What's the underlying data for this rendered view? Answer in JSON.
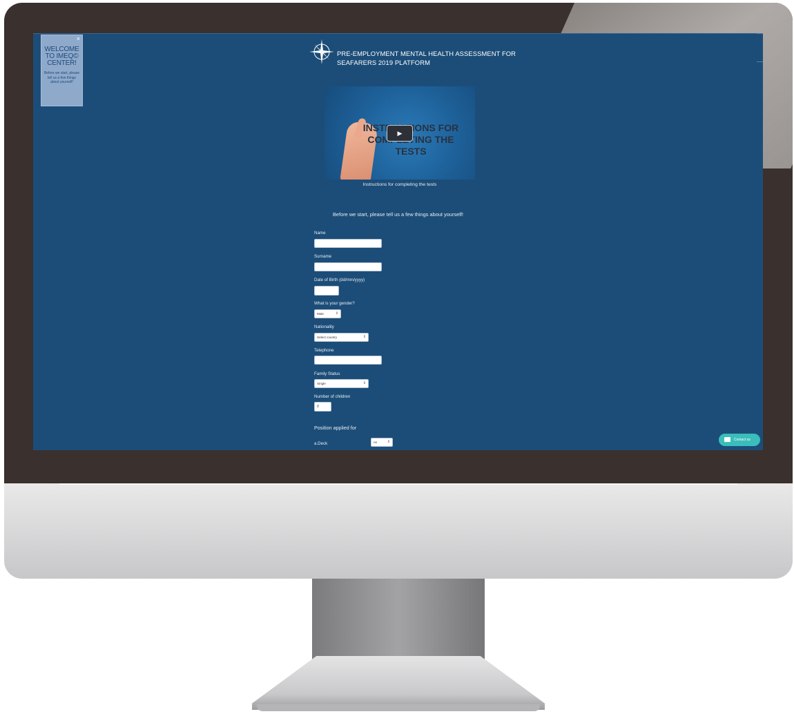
{
  "welcome_popup": {
    "close": "×",
    "title": "WELCOME TO IMEQ© CENTER!",
    "body": "Before we start, please tell us a few things about yourself!"
  },
  "header": {
    "title_line1": "PRE-EMPLOYMENT MENTAL HEALTH ASSESSMENT FOR",
    "title_line2": "SEAFARERS 2019 PLATFORM",
    "logo_icon": "compass-rose-icon"
  },
  "video": {
    "overlay_text": "INSTRUCTIONS FOR COMPLETING THE TESTS",
    "play_icon": "play-icon",
    "play_glyph": "▶",
    "caption": "Instructions for completing the tests"
  },
  "intro": "Before we start, please tell us a few things about yourself!",
  "form": {
    "name_label": "Name",
    "name_value": "",
    "surname_label": "Surname",
    "surname_value": "",
    "dob_label": "Date of Birth (dd/mm/yyyy)",
    "dob_value": "",
    "gender_label": "What is your gender?",
    "gender_value": "Male",
    "nationality_label": "Nationality",
    "nationality_value": "Select country",
    "telephone_label": "Telephone",
    "telephone_value": "",
    "family_status_label": "Family Status",
    "family_status_value": "Single",
    "children_label": "Number of children",
    "children_value": "0",
    "position_heading": "Position applied for",
    "deck_label": "a.Deck",
    "deck_value": "no",
    "select_arrow": "⇕"
  },
  "contact": {
    "label": "Contact us",
    "icon": "chat-bubble-icon"
  },
  "colors": {
    "screen_bg": "#1c4d78",
    "contact_button": "#3bbdbb",
    "popup_bg": "#8fa9cb"
  }
}
